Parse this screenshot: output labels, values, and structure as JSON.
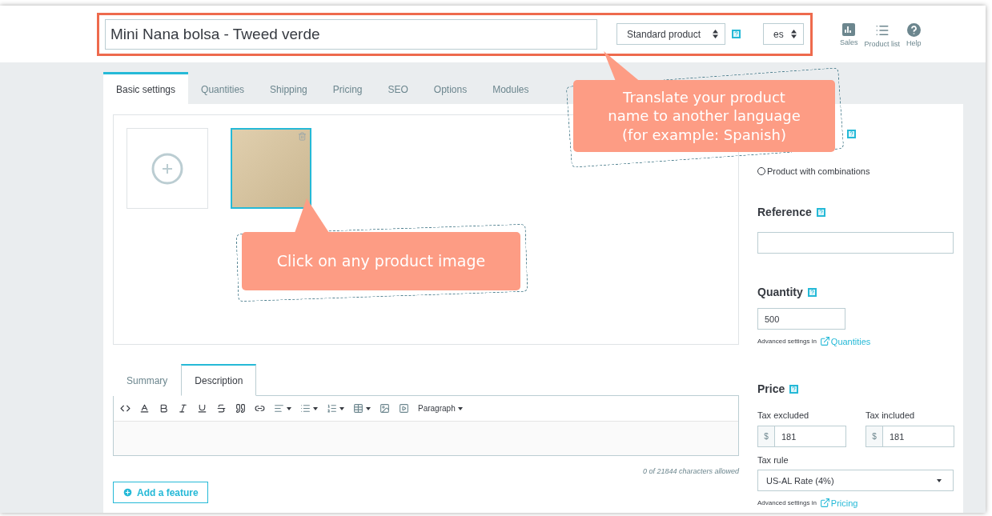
{
  "header": {
    "product_name": "Mini Nana bolsa - Tweed verde",
    "product_type": "Standard product",
    "language": "es",
    "actions": [
      {
        "kind": "chart",
        "label": "Sales"
      },
      {
        "kind": "list",
        "label": "Product list"
      },
      {
        "kind": "help",
        "label": "Help"
      }
    ]
  },
  "tabs": [
    {
      "label": "Basic settings",
      "selected": true
    },
    {
      "label": "Quantities",
      "selected": false
    },
    {
      "label": "Shipping",
      "selected": false
    },
    {
      "label": "Pricing",
      "selected": false
    },
    {
      "label": "SEO",
      "selected": false
    },
    {
      "label": "Options",
      "selected": false
    },
    {
      "label": "Modules",
      "selected": false
    }
  ],
  "images": [
    {
      "kind": "add",
      "selected": false
    },
    {
      "kind": "photo",
      "selected": true
    }
  ],
  "description_tabs": [
    {
      "label": "Summary",
      "selected": false
    },
    {
      "label": "Description",
      "selected": true
    }
  ],
  "editor": {
    "format": "Paragraph",
    "counter": "0 of 21844 characters allowed"
  },
  "add_feature_button": "Add a feature",
  "sidebar": {
    "type_options": [
      {
        "label": "Product with combinations",
        "selected": false
      }
    ],
    "reference": {
      "label": "Reference"
    },
    "quantity": {
      "label": "Quantity",
      "value": "500",
      "advanced": "Advanced settings in",
      "link": "Quantities"
    },
    "price": {
      "label": "Price",
      "fields": [
        {
          "label": "Tax excluded",
          "currency": "$",
          "value": "181"
        },
        {
          "label": "Tax included",
          "currency": "$",
          "value": "181"
        }
      ],
      "tax_rule": {
        "label": "Tax rule",
        "value": "US-AL Rate (4%)"
      },
      "advanced": "Advanced settings in",
      "link": "Pricing"
    }
  },
  "callouts": [
    {
      "kind": "language",
      "text": "Translate your product name to another language (for example: Spanish)"
    },
    {
      "kind": "image",
      "text": "Click on any product image"
    }
  ]
}
